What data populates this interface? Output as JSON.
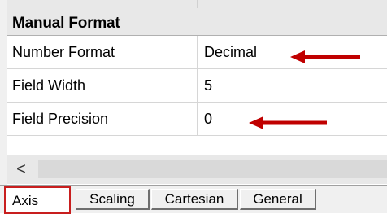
{
  "section": {
    "title": "Manual Format"
  },
  "properties": [
    {
      "name": "Number Format",
      "value": "Decimal"
    },
    {
      "name": "Field Width",
      "value": "5"
    },
    {
      "name": "Field Precision",
      "value": "0"
    }
  ],
  "scrollbar": {
    "left_arrow": "<"
  },
  "tabs": [
    {
      "label": "Axis"
    },
    {
      "label": "Scaling"
    },
    {
      "label": "Cartesian"
    },
    {
      "label": "General"
    }
  ],
  "colors": {
    "annotation_arrow": "#c00000",
    "active_tab_outline": "#c81e1e"
  },
  "icons": {
    "annotation": "red-arrow-icon",
    "scroll_left": "chevron-left-icon"
  }
}
